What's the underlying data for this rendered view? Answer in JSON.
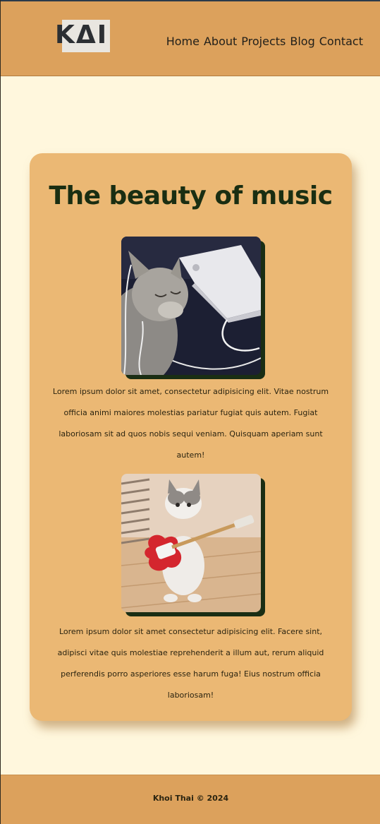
{
  "header": {
    "logo_text": "KΔI",
    "nav": [
      "Home",
      "About",
      "Projects",
      "Blog",
      "Contact"
    ]
  },
  "main": {
    "title": "The beauty of music",
    "sections": [
      {
        "image_alt": "cat listening to music with headphones next to a laptop",
        "text": "Lorem ipsum dolor sit amet, consectetur adipisicing elit. Vitae nostrum officia animi maiores molestias pariatur fugiat quis autem. Fugiat laboriosam sit ad quos nobis sequi veniam. Quisquam aperiam sunt autem!"
      },
      {
        "image_alt": "kitten standing holding a red electric guitar",
        "text": "Lorem ipsum dolor sit amet consectetur adipisicing elit. Facere sint, adipisci vitae quis molestiae reprehenderit a illum aut, rerum aliquid perferendis porro asperiores esse harum fuga! Eius nostrum officia laboriosam!"
      }
    ]
  },
  "footer": {
    "text": "Khoi Thai © 2024"
  },
  "colors": {
    "header_bg": "#dca15c",
    "page_bg": "#fff7dd",
    "card_bg": "#ebb874",
    "title": "#1a2e12",
    "photo_shadow": "#1a2e14"
  }
}
